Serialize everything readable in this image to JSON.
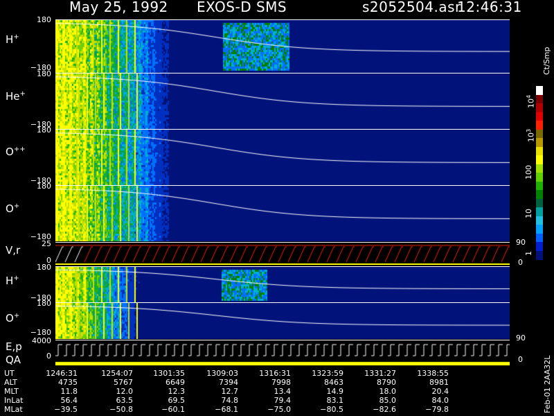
{
  "header": {
    "date": "May 25, 1992",
    "mission": "EXOS-D SMS",
    "file": "s2052504.asr",
    "time": "12:46:31"
  },
  "panels": [
    {
      "label": "H",
      "charge": "+",
      "ytop": "180",
      "ybot": "−180"
    },
    {
      "label": "He",
      "charge": "+",
      "ytop": "180",
      "ybot": "−180"
    },
    {
      "label": "O",
      "charge": "++",
      "ytop": "180",
      "ybot": "−180"
    },
    {
      "label": "O",
      "charge": "+",
      "ytop": "180",
      "ybot": "−180"
    }
  ],
  "vr_panel": {
    "label": "V,r",
    "ytop": "25",
    "ybot": "0",
    "rtop": "90",
    "rbot": "0"
  },
  "lower_panels": [
    {
      "label": "H",
      "charge": "+",
      "ytop": "180",
      "ybot": "−180"
    },
    {
      "label": "O",
      "charge": "+",
      "ytop": "180",
      "ybot": "−180"
    }
  ],
  "ep_panel": {
    "label1": "E,p",
    "label2": "QA",
    "ytop": "4000",
    "ybot": "0",
    "rtop": "90",
    "rbot": "0"
  },
  "colorbar": {
    "unit": "Ct/Smp",
    "ticks": [
      {
        "text": "10",
        "sup": "4"
      },
      {
        "text": "10",
        "sup": "3"
      },
      {
        "text": "100",
        "sup": ""
      },
      {
        "text": "10",
        "sup": ""
      },
      {
        "text": "1",
        "sup": ""
      }
    ],
    "colors": [
      "#ffffff",
      "#7a0000",
      "#b00000",
      "#e00000",
      "#ff2000",
      "#7a6a00",
      "#b89a00",
      "#e8e000",
      "#ffff00",
      "#a0e000",
      "#60d000",
      "#20b000",
      "#008000",
      "#006040",
      "#00a0a0",
      "#20c0e0",
      "#00a0ff",
      "#0060ff",
      "#0020d0",
      "#01127a"
    ]
  },
  "footer": {
    "rows": [
      {
        "name": "UT",
        "values": [
          "1246:31",
          "1254:07",
          "1301:35",
          "1309:03",
          "1316:31",
          "1323:59",
          "1331:27",
          "1338:55"
        ]
      },
      {
        "name": "ALT",
        "values": [
          "4735",
          "5767",
          "6649",
          "7394",
          "7998",
          "8463",
          "8790",
          "8981"
        ]
      },
      {
        "name": "MLT",
        "values": [
          "11.8",
          "12.0",
          "12.3",
          "12.7",
          "13.4",
          "14.9",
          "18.0",
          "20.4"
        ]
      },
      {
        "name": "InLat",
        "values": [
          "56.4",
          "63.5",
          "69.5",
          "74.8",
          "79.4",
          "83.1",
          "85.0",
          "84.0"
        ]
      },
      {
        "name": "MLat",
        "values": [
          "−39.5",
          "−50.8",
          "−60.1",
          "−68.1",
          "−75.0",
          "−80.5",
          "−82.6",
          "−79.8"
        ]
      }
    ],
    "side_label": "Feb-01 2AA32L"
  },
  "chart_data": {
    "type": "heatmap",
    "title": "May 25, 1992   EXOS-D SMS",
    "x": [
      "1246:31",
      "1254:07",
      "1301:35",
      "1309:03",
      "1316:31",
      "1323:59",
      "1331:27",
      "1338:55"
    ],
    "ylim": [
      -180,
      180
    ],
    "colorbar_unit": "Ct/Smp",
    "colorbar_range": [
      1,
      10000
    ],
    "series": [
      {
        "name": "H+",
        "ylim": [
          -180,
          180
        ]
      },
      {
        "name": "He+",
        "ylim": [
          -180,
          180
        ]
      },
      {
        "name": "O++",
        "ylim": [
          -180,
          180
        ]
      },
      {
        "name": "O+",
        "ylim": [
          -180,
          180
        ]
      },
      {
        "name": "V,r",
        "ylim": [
          0,
          25
        ]
      },
      {
        "name": "H+",
        "ylim": [
          -180,
          180
        ]
      },
      {
        "name": "O+",
        "ylim": [
          -180,
          180
        ]
      },
      {
        "name": "E,p",
        "ylim": [
          0,
          4000
        ]
      }
    ]
  }
}
